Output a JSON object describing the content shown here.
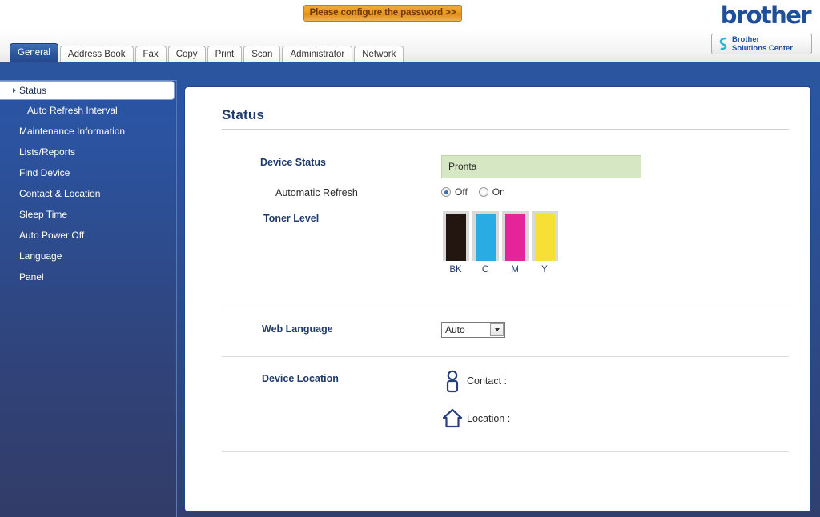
{
  "banner": {
    "password_button": "Please configure the password >>",
    "brand_logo": "brother"
  },
  "solutions_center": {
    "line1": "Brother",
    "line2": "Solutions Center",
    "icon": "brother-swirl-icon"
  },
  "tabs": [
    {
      "label": "General",
      "active": true
    },
    {
      "label": "Address Book",
      "active": false
    },
    {
      "label": "Fax",
      "active": false
    },
    {
      "label": "Copy",
      "active": false
    },
    {
      "label": "Print",
      "active": false
    },
    {
      "label": "Scan",
      "active": false
    },
    {
      "label": "Administrator",
      "active": false
    },
    {
      "label": "Network",
      "active": false
    }
  ],
  "sidebar": {
    "items": [
      {
        "label": "Status",
        "selected": true,
        "sub": false
      },
      {
        "label": "Auto Refresh Interval",
        "selected": false,
        "sub": true
      },
      {
        "label": "Maintenance Information",
        "selected": false,
        "sub": false
      },
      {
        "label": "Lists/Reports",
        "selected": false,
        "sub": false
      },
      {
        "label": "Find Device",
        "selected": false,
        "sub": false
      },
      {
        "label": "Contact & Location",
        "selected": false,
        "sub": false
      },
      {
        "label": "Sleep Time",
        "selected": false,
        "sub": false
      },
      {
        "label": "Auto Power Off",
        "selected": false,
        "sub": false
      },
      {
        "label": "Language",
        "selected": false,
        "sub": false
      },
      {
        "label": "Panel",
        "selected": false,
        "sub": false
      }
    ]
  },
  "main": {
    "title": "Status",
    "device_status": {
      "label": "Device Status",
      "value": "Pronta",
      "field_color": "#d6e8c3"
    },
    "automatic_refresh": {
      "label": "Automatic Refresh",
      "selected": "Off",
      "options": [
        "Off",
        "On"
      ]
    },
    "toner_level": {
      "label": "Toner Level",
      "cartridges": [
        {
          "name": "BK",
          "color": "#231611",
          "level": 95
        },
        {
          "name": "C",
          "color": "#29ace3",
          "level": 95
        },
        {
          "name": "M",
          "color": "#e5249a",
          "level": 95
        },
        {
          "name": "Y",
          "color": "#f7df36",
          "level": 95
        }
      ]
    },
    "web_language": {
      "label": "Web Language",
      "value": "Auto",
      "options": [
        "Auto"
      ]
    },
    "device_location": {
      "label": "Device Location",
      "contact": {
        "label": "Contact :",
        "value": "",
        "icon": "person-icon"
      },
      "location": {
        "label": "Location :",
        "value": "",
        "icon": "home-icon"
      }
    }
  },
  "theme": {
    "brand_blue": "#1d4f9c",
    "sidebar_blue": "#2a55a2",
    "accent_orange": "#e08c15",
    "status_green": "#d6e8c3"
  }
}
